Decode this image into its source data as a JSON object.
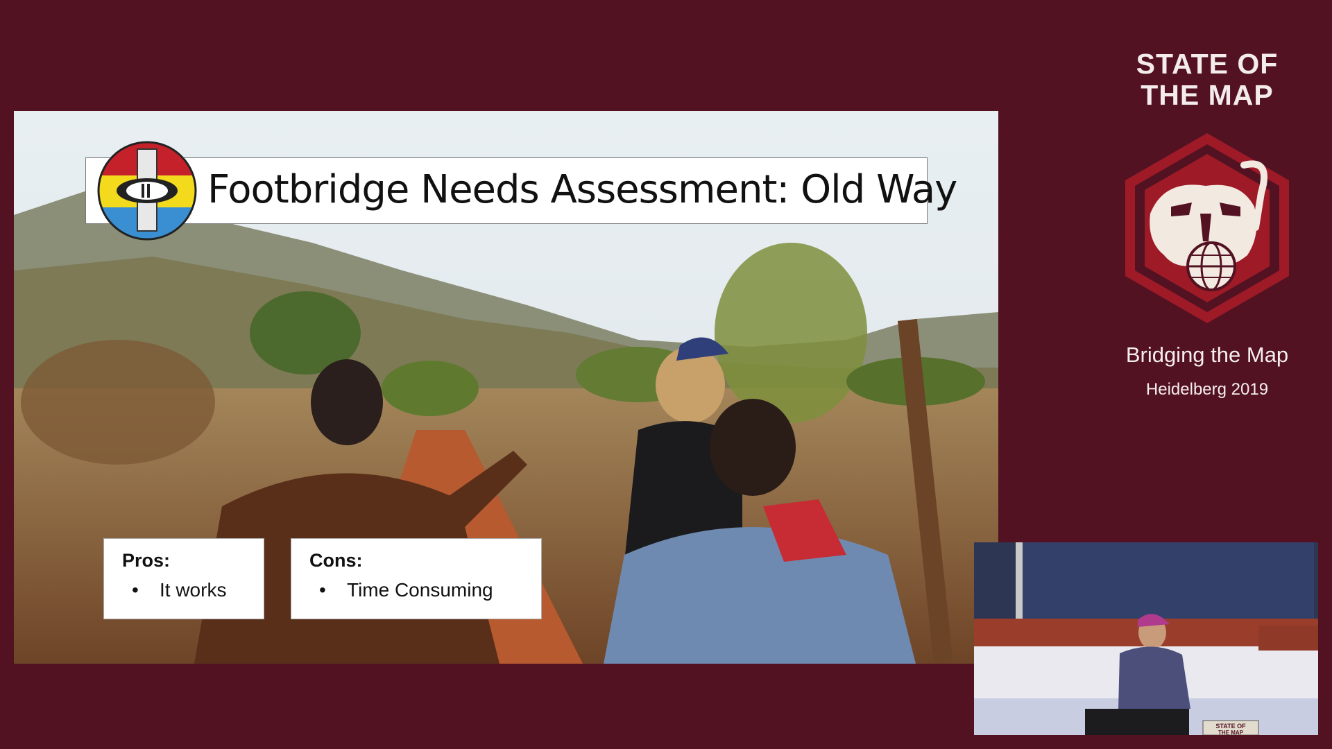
{
  "slide": {
    "title": "Footbridge Needs Assessment: Old Way",
    "pros": {
      "heading": "Pros:",
      "items": [
        "It works"
      ]
    },
    "cons": {
      "heading": "Cons:",
      "items": [
        "Time Consuming"
      ]
    },
    "bullet_glyph": "•"
  },
  "branding": {
    "title_line1": "STATE OF",
    "title_line2": "THE MAP",
    "subtitle": "Bridging the Map",
    "place": "Heidelberg 2019",
    "logo_icon": "sotm-lion-globe-hexagon-icon",
    "colors": {
      "background": "#521222",
      "hexagon": "#9e1a27",
      "text": "#f4ecec"
    }
  },
  "webcam": {
    "podium_label_line1": "STATE OF",
    "podium_label_line2": "THE MAP"
  }
}
